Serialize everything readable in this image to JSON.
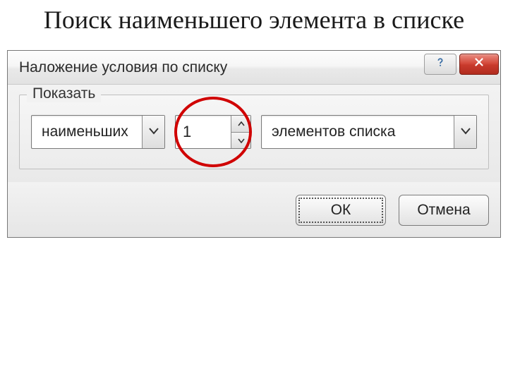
{
  "slide": {
    "title": "Поиск наименьшего элемента в списке"
  },
  "dialog": {
    "title": "Наложение условия по списку",
    "group_label": "Показать",
    "mode_selected": "наименьших",
    "count_value": "1",
    "unit_selected": "элементов списка",
    "ok_label": "ОК",
    "cancel_label": "Отмена"
  },
  "colors": {
    "highlight": "#d00000",
    "close_btn": "#c83a2c"
  }
}
